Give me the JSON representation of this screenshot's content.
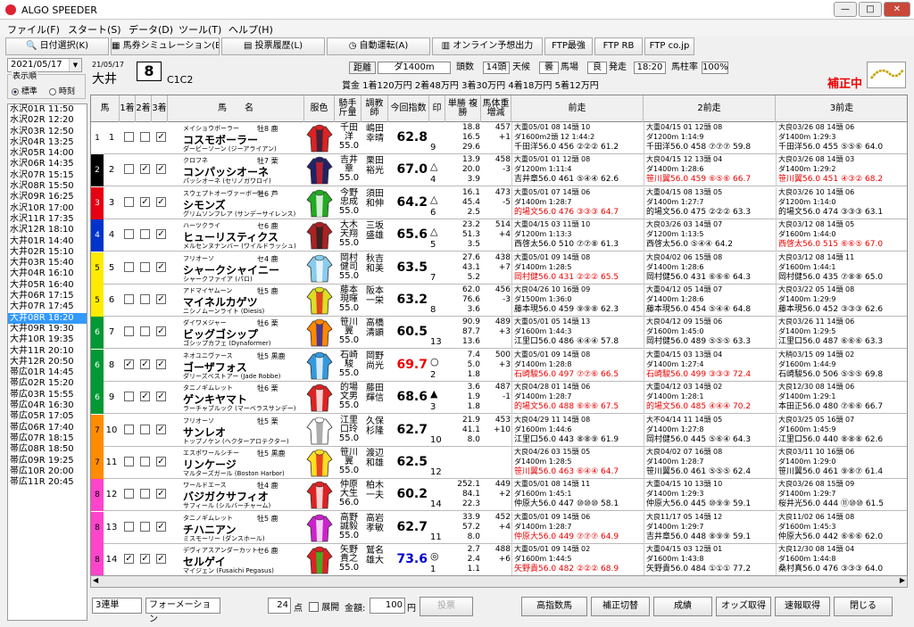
{
  "app": {
    "title": "ALGO SPEEDER",
    "controls": [
      "—",
      "□",
      "✕"
    ]
  },
  "menu": [
    "ファイル(F)",
    "スタート(S)",
    "データ(D)",
    "ツール(T)",
    "ヘルプ(H)"
  ],
  "toolbar": [
    "日付選択(K)",
    "馬券シミュレーション(B)",
    "投票履歴(L)",
    "自動運転(A)",
    "オンライン予想出力",
    "FTP最強",
    "FTP RB",
    "FTP co.jp"
  ],
  "sidebar": {
    "date": "2021/05/17",
    "sort_label": "表示順",
    "sort_opt1": "標準",
    "sort_opt2": "時刻",
    "races": [
      "水沢01R 11:50",
      "水沢02R 12:20",
      "水沢03R 12:50",
      "水沢04R 13:25",
      "水沢05R 14:00",
      "水沢06R 14:35",
      "水沢07R 15:15",
      "水沢08R 15:50",
      "水沢09R 16:25",
      "水沢10R 17:00",
      "水沢11R 17:35",
      "水沢12R 18:10",
      "大井01R 14:40",
      "大井02R 15:10",
      "大井03R 15:40",
      "大井04R 16:10",
      "大井05R 16:40",
      "大井06R 17:15",
      "大井07R 17:45",
      "大井08R 18:20",
      "大井09R 19:30",
      "大井10R 19:35",
      "大井11R 20:10",
      "大井12R 20:50",
      "帯広01R 14:45",
      "帯広02R 15:20",
      "帯広03R 15:55",
      "帯広04R 16:30",
      "帯広05R 17:05",
      "帯広06R 17:40",
      "帯広07R 18:15",
      "帯広08R 18:50",
      "帯広09R 19:25",
      "帯広10R 20:00",
      "帯広11R 20:45"
    ],
    "selected": 19
  },
  "race": {
    "date": "21/05/17",
    "place": "大井",
    "number": "8",
    "class": "C1C2",
    "dist_label": "距離",
    "dist": "ダ1400m",
    "heads_label": "頭数",
    "heads": "14頭",
    "weather_label": "天候",
    "weather": "曇",
    "track_label": "馬場",
    "track": "良",
    "start_label": "発走",
    "start": "18:20",
    "rate_label": "馬柱率",
    "rate": "100%",
    "prize": "賞金 1着120万円  2着48万円  3着30万円  4着18万円  5着12万円",
    "hosei": "補正中"
  },
  "headers": {
    "uma": "馬",
    "c1": "1着",
    "c2": "2着",
    "c3": "3着",
    "name": "馬　　名",
    "silk": "服色",
    "jockey": "騎手 斤量",
    "trainer": "調教 師",
    "score": "今回指数",
    "mark": "印",
    "odds": "単勝 複勝",
    "weight": "馬体重 増減",
    "p1": "前走",
    "p2": "2前走",
    "p3": "3前走"
  },
  "colors": {
    "w1": "#ffffff",
    "w2": "#000000",
    "w3": "#e60012",
    "w4": "#0033cc",
    "w5": "#ffeb00",
    "w6": "#009933",
    "w7": "#ff8c00",
    "w8": "#ff44cc"
  },
  "horses": [
    {
      "waku": "1",
      "no": "1",
      "c": [
        false,
        false,
        true
      ],
      "sire": "メイショウボーラー",
      "sex": "牡8 鹿",
      "name": "コスモボーラー",
      "dam": "ダービーソーン (ジーアライアン)",
      "jockey": "千田 洋 55.0",
      "trainer": "嶋田 幸晴",
      "score": "62.8",
      "mark": "",
      "pop": "9",
      "odds": "18.8 16.5 29.6",
      "wt": "457 +1",
      "p1": {
        "h": "大重05/01 08 14頭 10",
        "l2": "ダ1600m2頭 12 1:44:2",
        "l3": "千田洋56.0 456 ②②② 61.2",
        "o": "10",
        "s": "61.2",
        "r": false
      },
      "p2": {
        "h": "大重04/15 01 12頭 08",
        "l2": "ダ1200m 1:14:9",
        "l3": "千田洋56.0 458 ⑦⑦⑦ 59.8",
        "o": "08",
        "s": "59.8",
        "r": false
      },
      "p3": {
        "h": "大良03/26 08 14頭 06",
        "l2": "ダ1400m 1:29:3",
        "l3": "千田洋56.0 455 ⑤⑤⑥ 64.0",
        "o": "06",
        "s": "64.0",
        "r": false
      }
    },
    {
      "waku": "2",
      "no": "2",
      "c": [
        false,
        true,
        true
      ],
      "sire": "クロフネ",
      "sex": "牡7 栗",
      "name": "コンパッシオーネ",
      "dam": "パッシオーネ (セリノガワロイ)",
      "jockey": "吉井 章 55.0",
      "trainer": "栗田 裕光",
      "score": "67.0",
      "mark": "△",
      "pop": "4",
      "odds": "13.9 20.0 3.9",
      "wt": "458 -3",
      "p1": {
        "h": "大重05/01 01 12頭 08",
        "l2": "ダ1200m 1:11:4",
        "l3": "吉井章56.0 461 ⑤④④ 62.6",
        "o": "08",
        "s": "62.6",
        "r": false
      },
      "p2": {
        "h": "大良04/15 12 13頭 04",
        "l2": "ダ1400m 1:28:6",
        "l3": "笹川翼56.0 459 ⑥⑤⑥ 66.7",
        "o": "04",
        "s": "66.7",
        "r": true
      },
      "p3": {
        "h": "大良03/26 08 14頭 03",
        "l2": "ダ1400m 1:29:2",
        "l3": "笹川翼56.0 451 ④③② 68.2",
        "o": "03",
        "s": "68.2",
        "r": true
      }
    },
    {
      "waku": "3",
      "no": "3",
      "c": [
        false,
        true,
        true
      ],
      "sire": "スウェプトオーヴァーボード",
      "sex": "牡6 芦",
      "name": "シモンズ",
      "dam": "グリムソンフレア (サンデーサイレンス)",
      "jockey": "今野 忠成 55.0",
      "trainer": "須田 和伸",
      "score": "64.2",
      "mark": "△",
      "pop": "6",
      "odds": "16.1 45.4 2.5",
      "wt": "473 -5",
      "p1": {
        "h": "大重05/01 07 14頭 06",
        "l2": "ダ1400m 1:28:7",
        "l3": "的場文56.0 476 ③③③ 64.7",
        "o": "06",
        "s": "64.7",
        "r": true
      },
      "p2": {
        "h": "大重04/15 08 13頭 05",
        "l2": "ダ1400m 1:27:7",
        "l3": "的場文56.0 475 ②②② 63.3",
        "o": "05",
        "s": "63.3",
        "r": false
      },
      "p3": {
        "h": "大良03/26 10 14頭 06",
        "l2": "ダ1200m 1:14:0",
        "l3": "的場文56.0 474 ③③③ 63.1",
        "o": "06",
        "s": "63.1",
        "r": false
      }
    },
    {
      "waku": "4",
      "no": "4",
      "c": [
        false,
        false,
        true
      ],
      "sire": "ハーツクライ",
      "sex": "セ6 鹿",
      "name": "ヒューリスティクス",
      "dam": "メルセンヌナンバー (ワイルドラッシュ)",
      "jockey": "大木 天翔 55.0",
      "trainer": "三坂 盛雄",
      "score": "65.6",
      "mark": "△",
      "pop": "5",
      "odds": "23.2 51.3 3.5",
      "wt": "514 +4",
      "p1": {
        "h": "大重04/15 03 11頭 10",
        "l2": "ダ1200m 1:13:3",
        "l3": "西啓太56.0 510 ⑦⑦⑧ 61.3",
        "o": "10",
        "s": "61.3",
        "r": false
      },
      "p2": {
        "h": "大良03/26 03 14頭 07",
        "l2": "ダ1200m 1:13:5",
        "l3": "西啓太56.0 ⑤④④ 64.2",
        "o": "07",
        "s": "64.2",
        "r": false
      },
      "p3": {
        "h": "大良03/12 08 14頭 05",
        "l2": "ダ1600m 1:44:0",
        "l3": "西啓太56.0 515 ⑥⑥⑤ 67.0",
        "o": "05",
        "s": "67.0",
        "r": true
      }
    },
    {
      "waku": "5",
      "no": "5",
      "c": [
        false,
        false,
        true
      ],
      "sire": "フリオーソ",
      "sex": "セ4 鹿",
      "name": "シャークシャイニー",
      "dam": "シャークファイア (パロ)",
      "jockey": "岡村 健司 55.0",
      "trainer": "秋吉 和美",
      "score": "63.5",
      "mark": "",
      "pop": "7",
      "odds": "27.6 43.1 5.2",
      "wt": "438 +7",
      "p1": {
        "h": "大重05/01 09 14頭 08",
        "l2": "ダ1400m 1:28:5",
        "l3": "岡村健56.0 431 ②②② 65.5",
        "o": "08",
        "s": "65.5",
        "r": true
      },
      "p2": {
        "h": "大良04/02 06 15頭 08",
        "l2": "ダ1400m 1:28:6",
        "l3": "岡村健56.0 431 ⑥⑥⑥ 64.3",
        "o": "08",
        "s": "64.3",
        "r": false
      },
      "p3": {
        "h": "大良03/12 08 14頭 11",
        "l2": "ダ1600m 1:44:1",
        "l3": "岡村健56.0 435 ⑦⑧⑧ 65.0",
        "o": "11",
        "s": "65.0",
        "r": false
      }
    },
    {
      "waku": "5",
      "no": "6",
      "c": [
        false,
        false,
        true
      ],
      "sire": "アドマイヤムーン",
      "sex": "牡5 鹿",
      "name": "マイネルカゲツ",
      "dam": "ニシノムーンライト (Diesis)",
      "jockey": "藤本 現暉 55.0",
      "trainer": "阪本 一栄",
      "score": "63.2",
      "mark": "",
      "pop": "8",
      "odds": "62.0 76.6 3.6",
      "wt": "456 -3",
      "p1": {
        "h": "大良04/26 10 16頭 09",
        "l2": "ダ1500m 1:36:0",
        "l3": "藤本現56.0 459 ⑨⑨⑧ 62.3",
        "o": "09",
        "s": "62.3",
        "r": false
      },
      "p2": {
        "h": "大重04/12 05 14頭 07",
        "l2": "ダ1400m 1:28:6",
        "l3": "藤本現56.0 454 ⑤④④ 64.8",
        "o": "07",
        "s": "64.8",
        "r": false
      },
      "p3": {
        "h": "大良03/22 05 14頭 08",
        "l2": "ダ1400m 1:29:9",
        "l3": "藤本現56.0 452 ③③③ 62.6",
        "o": "08",
        "s": "62.6",
        "r": false
      }
    },
    {
      "waku": "6",
      "no": "7",
      "c": [
        false,
        false,
        true
      ],
      "sire": "ダイワメジャー",
      "sex": "牡6 栗",
      "name": "ビッグゴシップ",
      "dam": "ゴシップカフェ (Dynaformer)",
      "jockey": "笹川 翼 55.0",
      "trainer": "高橋 清顕",
      "score": "60.5",
      "mark": "",
      "pop": "13",
      "odds": "90.9 87.7 13.6",
      "wt": "489 +3",
      "p1": {
        "h": "大重05/01 05 14頭 13",
        "l2": "ダ1600m 1:44:3",
        "l3": "江里口56.0 486 ④④④ 57.8",
        "o": "13",
        "s": "57.8",
        "r": false
      },
      "p2": {
        "h": "大良04/12 09 15頭 06",
        "l2": "ダ1600m 1:45:0",
        "l3": "岡村健56.0 489 ⑤⑤⑤ 63.3",
        "o": "06",
        "s": "63.3",
        "r": false
      },
      "p3": {
        "h": "大良03/26 11 14頭 06",
        "l2": "ダ1400m 1:29:5",
        "l3": "江里口56.0 487 ⑥⑥⑥ 63.3",
        "o": "06",
        "s": "63.3",
        "r": false
      }
    },
    {
      "waku": "6",
      "no": "8",
      "c": [
        true,
        true,
        true
      ],
      "sire": "ネオユニヴァース",
      "sex": "牡5 黒鹿",
      "name": "ゴーザフォス",
      "dam": "ダリーズベストアー (Jade Robbe)",
      "jockey": "石崎 駿 55.0",
      "trainer": "岡野 尚光",
      "score": "69.7",
      "mark": "○",
      "pop": "2",
      "odds": "7.4 5.0 1.8",
      "wt": "500 +3",
      "p1": {
        "h": "大重05/01 09 14頭 08",
        "l2": "ダ1400m 1:28:8",
        "l3": "石崎駿56.0 497 ⑦⑦⑥ 66.5",
        "o": "08",
        "s": "66.5",
        "r": true
      },
      "p2": {
        "h": "大重04/15 03 13頭 04",
        "l2": "ダ1400m 1:27:4",
        "l3": "石崎駿56.0 499 ③③③ 72.4",
        "o": "04",
        "s": "72.4",
        "r": true
      },
      "p3": {
        "h": "大稍03/15 09 14頭 02",
        "l2": "ダ1600m 1:44:9",
        "l3": "石崎駿56.0 506 ⑤⑤⑤ 69.8",
        "o": "02",
        "s": "69.8",
        "r": false
      }
    },
    {
      "waku": "6",
      "no": "9",
      "c": [
        false,
        true,
        true
      ],
      "sire": "タニノギムレット",
      "sex": "牡6 栗",
      "name": "ゲンキヤマト",
      "dam": "ラーチャブルック (マーベラスサンデー)",
      "jockey": "的場 文男 55.0",
      "trainer": "藤田 輝信",
      "score": "68.6",
      "mark": "▲",
      "pop": "3",
      "odds": "3.6 1.9 1.8",
      "wt": "487 -1",
      "p1": {
        "h": "大良04/28 01 14頭 06",
        "l2": "ダ1400m 1:28:7",
        "l3": "的場文56.0 488 ⑥⑥⑥ 67.5",
        "o": "06",
        "s": "67.5",
        "r": true
      },
      "p2": {
        "h": "大重04/12 03 14頭 02",
        "l2": "ダ1400m 1:28:1",
        "l3": "的場文56.0 485 ④④④ 70.2",
        "o": "02",
        "s": "70.2",
        "r": true
      },
      "p3": {
        "h": "大良12/30 08 14頭 06",
        "l2": "ダ1400m 1:29:1",
        "l3": "本田正56.0 480 ⑦⑥⑥ 66.7",
        "o": "06",
        "s": "66.7",
        "r": false
      }
    },
    {
      "waku": "7",
      "no": "10",
      "c": [
        false,
        false,
        true
      ],
      "sire": "フリオーソ",
      "sex": "牡5 栗",
      "name": "サンレオ",
      "dam": "トップノケン (ヘクターアロテクター)",
      "jockey": "江里 口玲 55.0",
      "trainer": "久保 杉隆",
      "score": "62.7",
      "mark": "",
      "pop": "10",
      "odds": "21.9 41.1 8.0",
      "wt": "453 +10",
      "p1": {
        "h": "大良04/29 11 14頭 08",
        "l2": "ダ1600m 1:44:6",
        "l3": "江里口56.0 443 ⑧⑧⑨ 61.9",
        "o": "08",
        "s": "61.9",
        "r": false
      },
      "p2": {
        "h": "大不04/14 11 14頭 05",
        "l2": "ダ1400m 1:27:8",
        "l3": "岡村健56.0 445 ⑤⑥④ 64.3",
        "o": "05",
        "s": "64.3",
        "r": false
      },
      "p3": {
        "h": "大良03/25 05 16頭 07",
        "l2": "ダ1600m 1:45:9",
        "l3": "江里口56.0 440 ⑧⑧⑧ 62.6",
        "o": "07",
        "s": "62.6",
        "r": false
      }
    },
    {
      "waku": "7",
      "no": "11",
      "c": [
        false,
        false,
        true
      ],
      "sire": "エスポワールシチー",
      "sex": "牡5 黒鹿",
      "name": "リンケージ",
      "dam": "マルターズガール (Boston Harbor)",
      "jockey": "笹川 翼 55.0",
      "trainer": "渡辺 和雄",
      "score": "62.5",
      "mark": "",
      "pop": "12",
      "odds": "",
      "wt": "",
      "p1": {
        "h": "大良04/26 03 15頭 05",
        "l2": "ダ1400m 1:28:5",
        "l3": "笹川翼56.0 463 ⑥④④ 64.7",
        "o": "05",
        "s": "64.7",
        "r": true
      },
      "p2": {
        "h": "大良04/02 07 16頭 08",
        "l2": "ダ1400m 1:28:7",
        "l3": "笹川翼56.0 461 ⑤⑤⑤ 62.4",
        "o": "08",
        "s": "62.4",
        "r": false
      },
      "p3": {
        "h": "大良03/11 10 16頭 06",
        "l2": "ダ1400m 1:29:0",
        "l3": "笹川翼56.0 461 ⑨⑧⑦ 61.4",
        "o": "06",
        "s": "61.4",
        "r": false
      }
    },
    {
      "waku": "8",
      "no": "12",
      "c": [
        false,
        false,
        true
      ],
      "sire": "ワールドエース",
      "sex": "牡4 鹿",
      "name": "バジガクサフィオ",
      "dam": "サフィール (シルバーチャーム)",
      "jockey": "仲原 大生 56.0",
      "trainer": "柏木 一夫",
      "score": "60.2",
      "mark": "",
      "pop": "14",
      "odds": "252.1 84.1 22.3",
      "wt": "449 +2",
      "p1": {
        "h": "大重05/01 08 14頭 11",
        "l2": "ダ1600m 1:45:1",
        "l3": "仲原大56.0 447 ⑩⑩⑩ 58.1",
        "o": "11",
        "s": "58.1",
        "r": false
      },
      "p2": {
        "h": "大重04/15 10 13頭 10",
        "l2": "ダ1400m 1:29:3",
        "l3": "仲原大56.0 445 ⑩⑨⑨ 59.1",
        "o": "10",
        "s": "59.1",
        "r": false
      },
      "p3": {
        "h": "大良03/26 08 15頭 09",
        "l2": "ダ1400m 1:29:7",
        "l3": "桜井光56.0 444 ⑪⑩⑩ 61.5",
        "o": "09",
        "s": "61.5",
        "r": false
      }
    },
    {
      "waku": "8",
      "no": "13",
      "c": [
        false,
        false,
        true
      ],
      "sire": "タニノギムレット",
      "sex": "牡5 鹿",
      "name": "チハニアン",
      "dam": "ミスモーリー (ダンスホール)",
      "jockey": "高野 誠毅 55.0",
      "trainer": "高岩 孝敏",
      "score": "62.7",
      "mark": "",
      "pop": "11",
      "odds": "33.9 57.2 8.0",
      "wt": "452 +4",
      "p1": {
        "h": "大重05/01 09 14頭 06",
        "l2": "ダ1400m 1:28:7",
        "l3": "仲原大56.0 449 ⑦⑦⑦ 64.9",
        "o": "06",
        "s": "64.9",
        "r": true
      },
      "p2": {
        "h": "大良11/17 05 14頭 12",
        "l2": "ダ1400m 1:29:7",
        "l3": "吉井章56.0 448 ⑧⑨⑨ 59.1",
        "o": "12",
        "s": "59.1",
        "r": false
      },
      "p3": {
        "h": "大良11/02 06 14頭 08",
        "l2": "ダ1600m 1:45:3",
        "l3": "仲原大56.0 442 ⑥⑥⑥ 62.0",
        "o": "08",
        "s": "62.0",
        "r": false
      }
    },
    {
      "waku": "8",
      "no": "14",
      "c": [
        true,
        true,
        true
      ],
      "sire": "デヴィアスアンダーカット",
      "sex": "セ6 鹿",
      "name": "セルゲイ",
      "dam": "マイジェン (Fusaichi Pegasus)",
      "jockey": "矢野 貴之 55.0",
      "trainer": "鷲名 雄大",
      "score": "73.6",
      "mark": "◎",
      "pop": "1",
      "odds": "2.7 2.4 1.1",
      "wt": "488 +6",
      "p1": {
        "h": "大重05/01 09 14頭 02",
        "l2": "ダ1600m 1:44:5",
        "l3": "矢野貴56.0 482 ②②② 68.9",
        "o": "02",
        "s": "68.9",
        "r": true
      },
      "p2": {
        "h": "大重04/15 03 12頭 01",
        "l2": "ダ1600m 1:43:8",
        "l3": "矢野貴56.0 484 ①①① 77.2",
        "o": "01",
        "s": "77.2",
        "r": false
      },
      "p3": {
        "h": "大良12/30 08 14頭 04",
        "l2": "ダ1600m 1:44:8",
        "l3": "桑村真56.0 476 ③③③ 64.0",
        "o": "04",
        "s": "64.0",
        "r": false
      }
    }
  ],
  "bottom": {
    "bet": "3連単",
    "form": "フォーメーション",
    "points": "24",
    "points_unit": "点",
    "expand": "展開",
    "amount_label": "金額:",
    "amount": "100",
    "amount_unit": "円",
    "vote": "投票",
    "btns": [
      "高指数馬",
      "補正切替",
      "成績",
      "オッズ取得",
      "速報取得",
      "閉じる"
    ]
  }
}
